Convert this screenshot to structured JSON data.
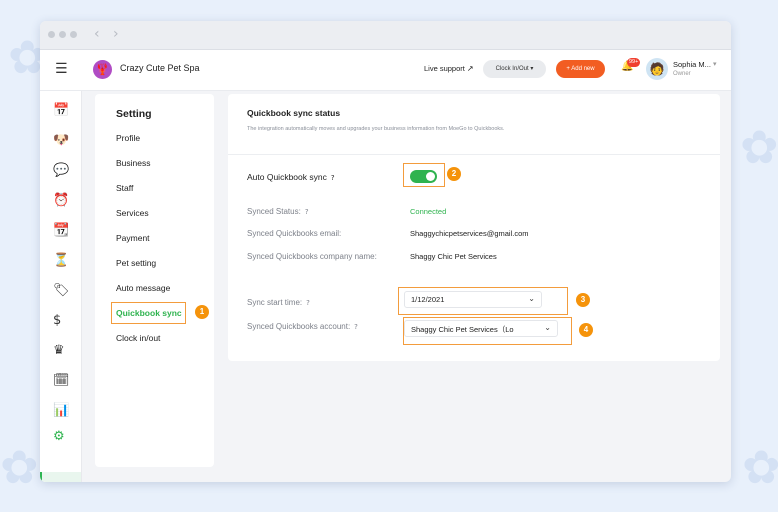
{
  "window": {
    "nav_back": "‹",
    "nav_forward": "›"
  },
  "header": {
    "menu_glyph": "☰",
    "logo_glyph": "🦞",
    "business_name": "Crazy Cute Pet Spa",
    "live_support": "Live support",
    "live_support_icon": "↗",
    "clock_button": "Clock In/Out",
    "add_new_button": "+ Add new",
    "bell_glyph": "🔔",
    "notification_count": "99+",
    "avatar_glyph": "🧑",
    "user_name": "Sophia M...",
    "user_caret": "▾",
    "user_role": "Owner"
  },
  "leftnav": {
    "icons": [
      {
        "name": "calendar-icon",
        "glyph": "📅"
      },
      {
        "name": "pet-face-icon",
        "glyph": "🐶"
      },
      {
        "name": "chat-icon",
        "glyph": "💬"
      },
      {
        "name": "alarm-clock-icon",
        "glyph": "⏰"
      },
      {
        "name": "schedule-icon",
        "glyph": "📆"
      },
      {
        "name": "hourglass-icon",
        "glyph": "⏳"
      },
      {
        "name": "tag-icon",
        "glyph": "🏷"
      },
      {
        "name": "dollar-icon",
        "glyph": "$"
      },
      {
        "name": "crown-icon",
        "glyph": "♛"
      },
      {
        "name": "calendar-check-icon",
        "glyph": "🗓"
      },
      {
        "name": "bar-chart-icon",
        "glyph": "📊"
      },
      {
        "name": "gear-icon",
        "glyph": "⚙"
      }
    ]
  },
  "settings": {
    "title": "Setting",
    "items": [
      "Profile",
      "Business",
      "Staff",
      "Services",
      "Payment",
      "Pet setting",
      "Auto message",
      "Quickbook sync",
      "Clock in/out"
    ],
    "active_index": 7
  },
  "content": {
    "title": "Quickbook sync status",
    "description": "The integration automatically moves and upgrades your business information from MoeGo to Quickbooks.",
    "help_glyph": "?",
    "auto_sync_label": "Auto Quickbook sync",
    "auto_sync_on": true,
    "synced_status_label": "Synced Status:",
    "synced_status_value": "Connected",
    "email_label": "Synced Quickbooks email:",
    "email_value": "Shaggychicpetservices@gmail.com",
    "company_label": "Synced Quickbooks company name:",
    "company_value": "Shaggy Chic Pet Services",
    "start_time_label": "Sync start time:",
    "start_time_value": "1/12/2021",
    "account_label": "Synced Quickbooks account:",
    "account_value": "Shaggy Chic Pet Services（Lo",
    "chevron_glyph": "⌄"
  },
  "annotations": [
    "1",
    "2",
    "3",
    "4"
  ],
  "colors": {
    "accent_green": "#2fb34f",
    "accent_orange": "#f25d22",
    "annotation_orange": "#f5930b"
  }
}
